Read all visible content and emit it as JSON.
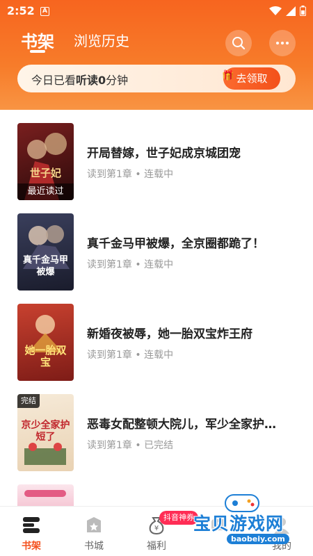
{
  "status": {
    "time": "2:52",
    "a_icon_letter": "A"
  },
  "header": {
    "tab_active": "书架",
    "tab_history": "浏览历史",
    "search_icon": "search-icon",
    "more_icon": "more-icon"
  },
  "reading_banner": {
    "prefix": "今日已看",
    "bold_text": "听读0",
    "suffix": "分钟",
    "claim_label": "去领取"
  },
  "books": [
    {
      "title": "开局替嫁，世子妃成京城团宠",
      "progress": "读到第1章 • 连载中",
      "cover_label": "最近读过",
      "cover_text": "世子妃",
      "cover_bg": "#5a1a1a"
    },
    {
      "title": "真千金马甲被爆，全京圈都跪了！",
      "progress": "读到第1章 • 连载中",
      "cover_text": "真千金马甲被爆",
      "cover_bg": "#2b2f4a"
    },
    {
      "title": "新婚夜被辱，她一胎双宝炸王府",
      "progress": "读到第1章 • 连载中",
      "cover_text": "她一胎双宝",
      "cover_bg": "#b8322b"
    },
    {
      "title": "恶毒女配整顿大院儿，军少全家护…",
      "progress": "读到第1章 • 已完结",
      "cover_tag": "完结",
      "cover_text": "京少全家护短了",
      "cover_bg": "#f2e4cf"
    }
  ],
  "bottom_nav": [
    {
      "label": "书架",
      "icon": "bookshelf-icon",
      "active": true
    },
    {
      "label": "书城",
      "icon": "bookstore-icon",
      "active": false
    },
    {
      "label": "福利",
      "icon": "welfare-icon",
      "active": false
    },
    {
      "label": "",
      "icon": "video-icon",
      "active": false
    },
    {
      "label": "我的",
      "icon": "profile-icon",
      "active": false
    }
  ],
  "promo_badge": "抖音神券",
  "watermark": {
    "text": "宝贝游戏网",
    "url": "baobeiy.com"
  },
  "colors": {
    "accent": "#f4511e",
    "header": "#f7651f"
  }
}
